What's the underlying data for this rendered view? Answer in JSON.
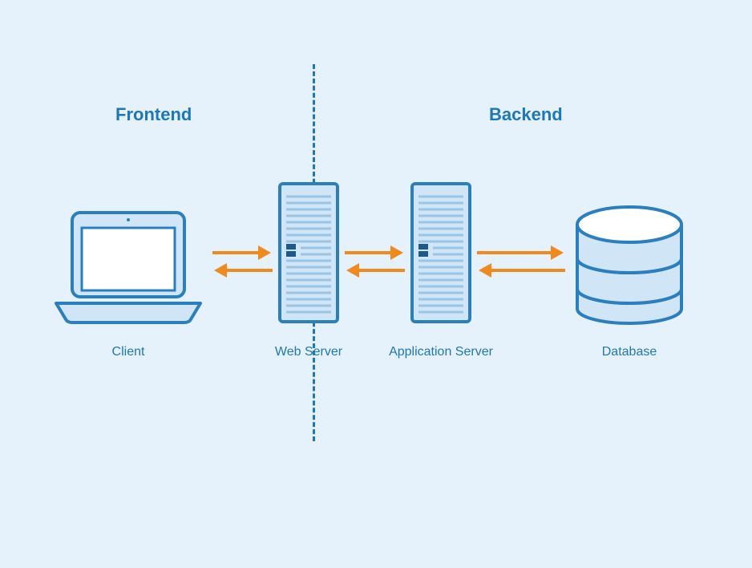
{
  "sections": {
    "frontend": "Frontend",
    "backend": "Backend"
  },
  "nodes": {
    "client": "Client",
    "web_server": "Web Server",
    "app_server": "Application Server",
    "database": "Database"
  },
  "colors": {
    "stroke": "#2a7fbf",
    "fill_light": "#d0e6f7",
    "fill_white": "#ffffff",
    "arrow": "#f08a1d",
    "text": "#1d77b8",
    "bg": "#e6f2fb"
  }
}
